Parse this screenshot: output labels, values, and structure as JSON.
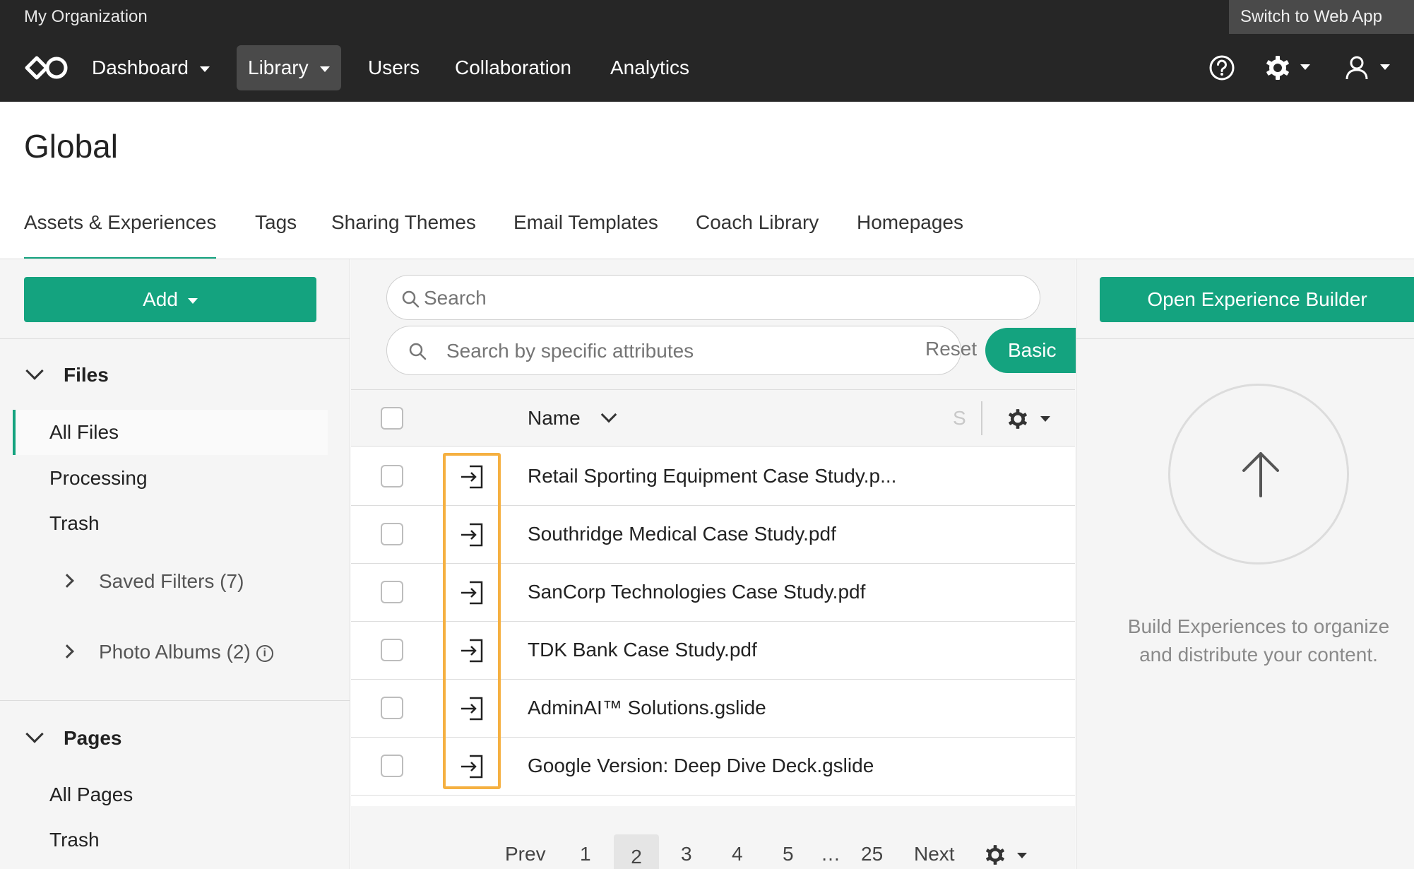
{
  "topbar": {
    "org_name": "My Organization",
    "switch_label": "Switch to Web App",
    "nav": [
      {
        "label": "Dashboard",
        "has_dropdown": true,
        "active": false
      },
      {
        "label": "Library",
        "has_dropdown": true,
        "active": true
      },
      {
        "label": "Users",
        "has_dropdown": false,
        "active": false
      },
      {
        "label": "Collaboration",
        "has_dropdown": false,
        "active": false
      },
      {
        "label": "Analytics",
        "has_dropdown": false,
        "active": false
      }
    ],
    "icons": [
      "help-icon",
      "gear-icon",
      "user-icon"
    ]
  },
  "page": {
    "title": "Global",
    "tabs": [
      "Assets & Experiences",
      "Tags",
      "Sharing Themes",
      "Email Templates",
      "Coach Library",
      "Homepages"
    ],
    "active_tab": "Assets & Experiences"
  },
  "sidebar": {
    "add_label": "Add",
    "files_heading": "Files",
    "files_items": [
      "All Files",
      "Processing",
      "Trash"
    ],
    "files_selected": "All Files",
    "saved_filters": "Saved Filters (7)",
    "photo_albums": "Photo Albums (2)",
    "pages_heading": "Pages",
    "pages_items": [
      "All Pages",
      "Trash"
    ]
  },
  "search": {
    "placeholder": "Search",
    "attr_placeholder": "Search by specific attributes",
    "reset_label": "Reset",
    "mode_label": "Basic"
  },
  "table": {
    "column_name": "Name",
    "column_truncated": "S",
    "rows": [
      {
        "name": "Retail Sporting Equipment Case Study.p..."
      },
      {
        "name": "Southridge Medical Case Study.pdf"
      },
      {
        "name": "SanCorp Technologies Case Study.pdf"
      },
      {
        "name": "TDK Bank Case Study.pdf"
      },
      {
        "name": "AdminAI™ Solutions.gslide"
      },
      {
        "name": "Google Version: Deep Dive Deck.gslide"
      }
    ],
    "highlight_color": "#f5b041"
  },
  "pagination": {
    "prev": "Prev",
    "pages": [
      "1",
      "2",
      "3",
      "4",
      "5"
    ],
    "ellipsis": "…",
    "last": "25",
    "next": "Next",
    "current": "2"
  },
  "right_panel": {
    "button_label": "Open Experience Builder",
    "empty_text": "Build Experiences to organize and distribute your content."
  },
  "colors": {
    "accent": "#14a37f",
    "topbar": "#262626",
    "highlight": "#f5b041"
  }
}
